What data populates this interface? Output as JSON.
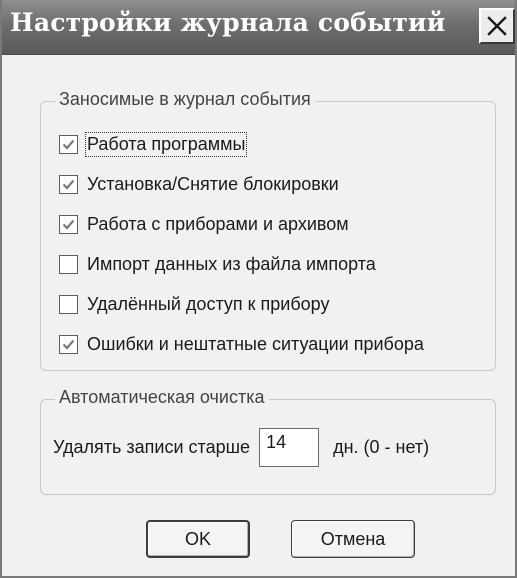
{
  "window": {
    "title": "Настройки журнала событий"
  },
  "icons": {
    "close": "close-icon",
    "check": "checkmark-icon"
  },
  "colors": {
    "titlebar": "#6e6e6e",
    "dialog_background": "#f1f1f1",
    "check_mark": "#7a7a7a"
  },
  "events_group": {
    "caption": "Заносимые в журнал события",
    "items": [
      {
        "label": "Работа программы",
        "checked": true
      },
      {
        "label": "Установка/Снятие блокировки",
        "checked": true
      },
      {
        "label": "Работа с приборами и архивом",
        "checked": true
      },
      {
        "label": "Импорт данных из файла импорта",
        "checked": false
      },
      {
        "label": "Удалённый доступ к прибору",
        "checked": false
      },
      {
        "label": "Ошибки и нештатные ситуации прибора",
        "checked": true
      }
    ]
  },
  "cleanup_group": {
    "caption": "Автоматическая очистка",
    "label": "Удалять записи старше",
    "days_value": "14",
    "suffix": "дн. (0 - нет)"
  },
  "buttons": {
    "ok_label": "OK",
    "cancel_label": "Отмена"
  }
}
